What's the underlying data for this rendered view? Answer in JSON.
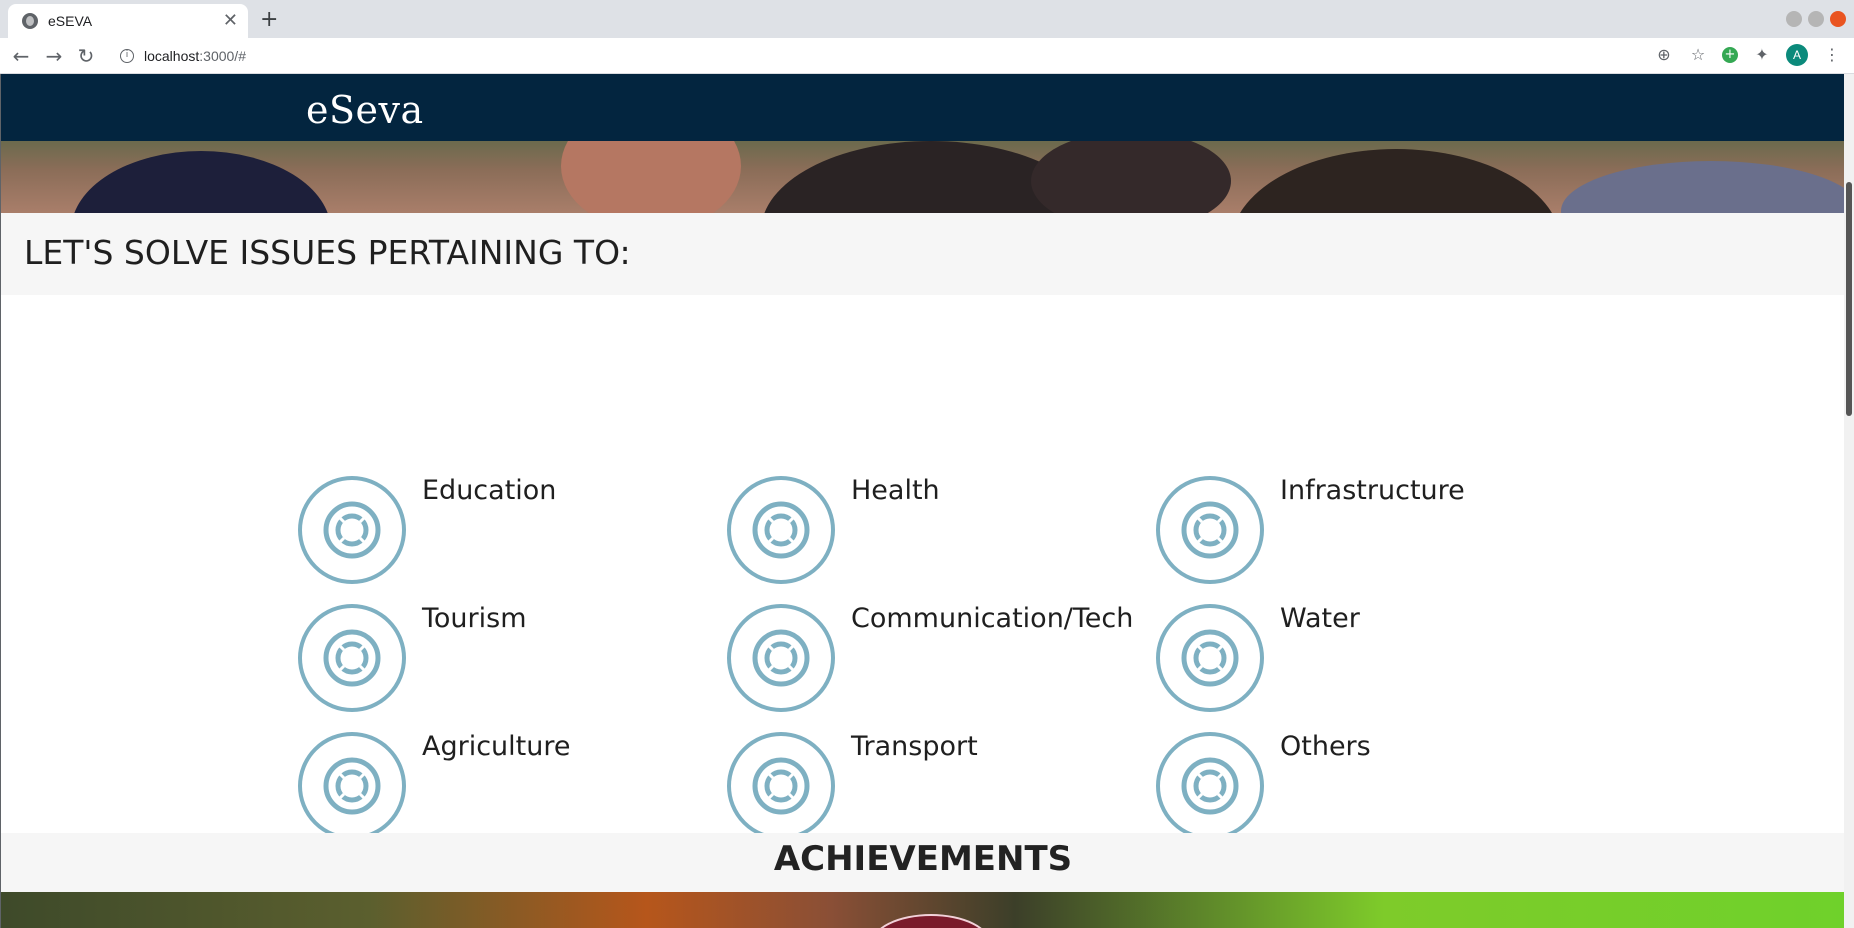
{
  "browser": {
    "tab_title": "eSEVA",
    "tab_close": "✕",
    "new_tab": "+",
    "url_host": "localhost",
    "url_rest": ":3000/#",
    "profile_initial": "A",
    "icons": [
      "back-arrow-icon",
      "forward-arrow-icon",
      "reload-icon",
      "info-icon",
      "zoom-icon",
      "star-icon",
      "extension-add-icon",
      "puzzle-icon",
      "menu-kebab-icon"
    ]
  },
  "header": {
    "logo_text": "eSeva"
  },
  "issues": {
    "heading": "LET'S SOLVE ISSUES PERTAINING TO:",
    "icon": "lifebuoy-icon",
    "accent_color": "#7eb0c2",
    "categories": [
      {
        "label": "Education"
      },
      {
        "label": "Health"
      },
      {
        "label": "Infrastructure"
      },
      {
        "label": "Tourism"
      },
      {
        "label": "Communication/Tech"
      },
      {
        "label": "Water"
      },
      {
        "label": "Agriculture"
      },
      {
        "label": "Transport"
      },
      {
        "label": "Others"
      }
    ]
  },
  "achievements": {
    "heading": "ACHIEVEMENTS"
  }
}
